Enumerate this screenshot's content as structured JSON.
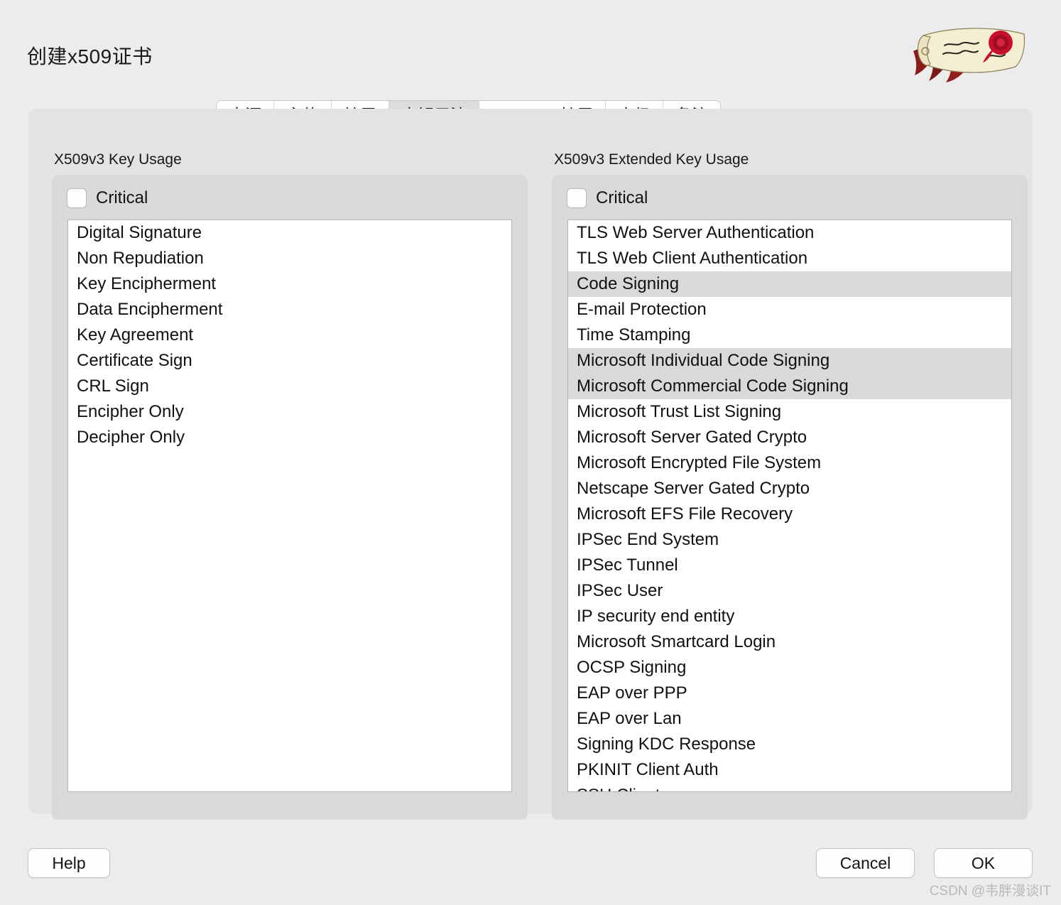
{
  "window": {
    "title": "创建x509证书",
    "logo_name": "xca-scroll-rose-logo"
  },
  "tabs": [
    {
      "label": "来源",
      "selected": false
    },
    {
      "label": "主体",
      "selected": false
    },
    {
      "label": "扩展",
      "selected": false
    },
    {
      "label": "密钥用法",
      "selected": true
    },
    {
      "label": "Netscape扩展",
      "selected": false
    },
    {
      "label": "高级",
      "selected": false
    },
    {
      "label": "备注",
      "selected": false
    }
  ],
  "key_usage": {
    "caption": "X509v3 Key Usage",
    "critical_label": "Critical",
    "critical_checked": false,
    "items": [
      {
        "label": "Digital Signature",
        "selected": false
      },
      {
        "label": "Non Repudiation",
        "selected": false
      },
      {
        "label": "Key Encipherment",
        "selected": false
      },
      {
        "label": "Data Encipherment",
        "selected": false
      },
      {
        "label": "Key Agreement",
        "selected": false
      },
      {
        "label": "Certificate Sign",
        "selected": false
      },
      {
        "label": "CRL Sign",
        "selected": false
      },
      {
        "label": "Encipher Only",
        "selected": false
      },
      {
        "label": "Decipher Only",
        "selected": false
      }
    ]
  },
  "extended_key_usage": {
    "caption": "X509v3 Extended Key Usage",
    "critical_label": "Critical",
    "critical_checked": false,
    "items": [
      {
        "label": "TLS Web Server Authentication",
        "selected": false
      },
      {
        "label": "TLS Web Client Authentication",
        "selected": false
      },
      {
        "label": "Code Signing",
        "selected": true
      },
      {
        "label": "E-mail Protection",
        "selected": false
      },
      {
        "label": "Time Stamping",
        "selected": false
      },
      {
        "label": "Microsoft Individual Code Signing",
        "selected": true
      },
      {
        "label": "Microsoft Commercial Code Signing",
        "selected": true
      },
      {
        "label": "Microsoft Trust List Signing",
        "selected": false
      },
      {
        "label": "Microsoft Server Gated Crypto",
        "selected": false
      },
      {
        "label": "Microsoft Encrypted File System",
        "selected": false
      },
      {
        "label": "Netscape Server Gated Crypto",
        "selected": false
      },
      {
        "label": "Microsoft EFS File Recovery",
        "selected": false
      },
      {
        "label": "IPSec End System",
        "selected": false
      },
      {
        "label": "IPSec Tunnel",
        "selected": false
      },
      {
        "label": "IPSec User",
        "selected": false
      },
      {
        "label": "IP security end entity",
        "selected": false
      },
      {
        "label": "Microsoft Smartcard Login",
        "selected": false
      },
      {
        "label": "OCSP Signing",
        "selected": false
      },
      {
        "label": "EAP over PPP",
        "selected": false
      },
      {
        "label": "EAP over Lan",
        "selected": false
      },
      {
        "label": "Signing KDC Response",
        "selected": false
      },
      {
        "label": "PKINIT Client Auth",
        "selected": false
      },
      {
        "label": "SSH Client",
        "selected": false
      }
    ]
  },
  "footer": {
    "help_label": "Help",
    "cancel_label": "Cancel",
    "ok_label": "OK"
  },
  "watermark": "CSDN @韦胖漫谈IT",
  "colors": {
    "window_background": "#ececec",
    "panel_background": "#e3e3e3",
    "group_background": "#d9d9d9",
    "list_background": "#ffffff",
    "selection": "#d9d9d9",
    "tab_selected": "#dcdcdc",
    "logo_ribbon": "#8b1a1a",
    "logo_rose": "#c8102e",
    "logo_paper": "#f2ecd0"
  }
}
